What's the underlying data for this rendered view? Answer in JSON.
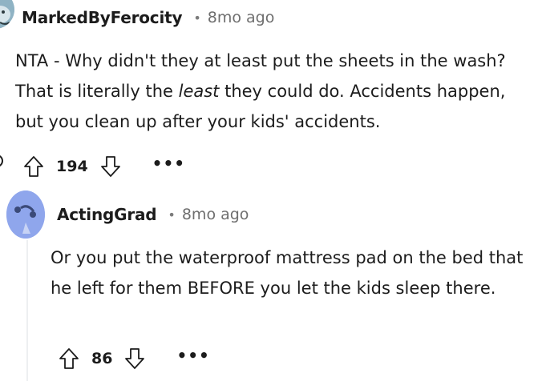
{
  "comments": [
    {
      "username": "MarkedByFerocity",
      "separator": "•",
      "time": "8mo ago",
      "body_start": "NTA - Why didn't they at least put the sheets in the wash? That is literally the ",
      "body_em": "least",
      "body_end": " they could do. Accidents happen, but you clean up after your kids' accidents.",
      "score": "194",
      "more": "•••",
      "avatar_color": "#8fb3c4"
    },
    {
      "username": "ActingGrad",
      "separator": "•",
      "time": "8mo ago",
      "body": "Or you put the waterproof mattress pad on the bed that he left for them BEFORE you let the kids sleep there.",
      "score": "86",
      "more": "•••",
      "avatar_color": "#8fa6ec"
    }
  ],
  "icons": {
    "upvote": "upvote-arrow-icon",
    "downvote": "downvote-arrow-icon",
    "more": "more-options-icon",
    "avatar": "snoo-avatar-icon",
    "collapse": "collapse-thread-icon"
  }
}
